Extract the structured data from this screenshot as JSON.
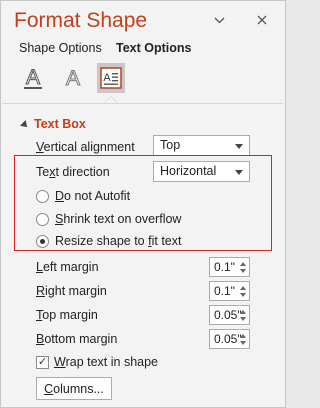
{
  "pane": {
    "title": "Format Shape",
    "dropdown_icon": "chevron-down-icon",
    "close_icon": "close-icon"
  },
  "tabs": [
    {
      "label": "Shape Options",
      "active": false
    },
    {
      "label": "Text Options",
      "active": true
    }
  ],
  "icon_tabs": [
    {
      "name": "text-fill-outline-icon",
      "active": false
    },
    {
      "name": "text-effects-icon",
      "active": false
    },
    {
      "name": "textbox-icon",
      "active": true
    }
  ],
  "section": {
    "title": "Text Box",
    "expanded": true
  },
  "vertical_alignment": {
    "label_pre": "",
    "label_ul": "V",
    "label_post": "ertical alignment",
    "value": "Top"
  },
  "text_direction": {
    "label_pre": "Te",
    "label_ul": "x",
    "label_post": "t direction",
    "value": "Horizontal"
  },
  "autofit": {
    "options": [
      {
        "pre": "",
        "ul": "D",
        "post": "o not Autofit",
        "checked": false
      },
      {
        "pre": "",
        "ul": "S",
        "post": "hrink text on overflow",
        "checked": false
      },
      {
        "pre": "Resize shape to ",
        "ul": "f",
        "post": "it text",
        "checked": true
      }
    ]
  },
  "margins": [
    {
      "pre": "",
      "ul": "L",
      "post": "eft margin",
      "value": "0.1\""
    },
    {
      "pre": "",
      "ul": "R",
      "post": "ight margin",
      "value": "0.1\""
    },
    {
      "pre": "",
      "ul": "T",
      "post": "op margin",
      "value": "0.05\""
    },
    {
      "pre": "",
      "ul": "B",
      "post": "ottom margin",
      "value": "0.05\""
    }
  ],
  "wrap": {
    "pre": "",
    "ul": "W",
    "post": "rap text in shape",
    "checked": true
  },
  "columns_button": {
    "pre": "",
    "ul": "C",
    "post": "olumns..."
  },
  "colors": {
    "accent": "#c43e1c",
    "highlight_box": "#e02020"
  }
}
